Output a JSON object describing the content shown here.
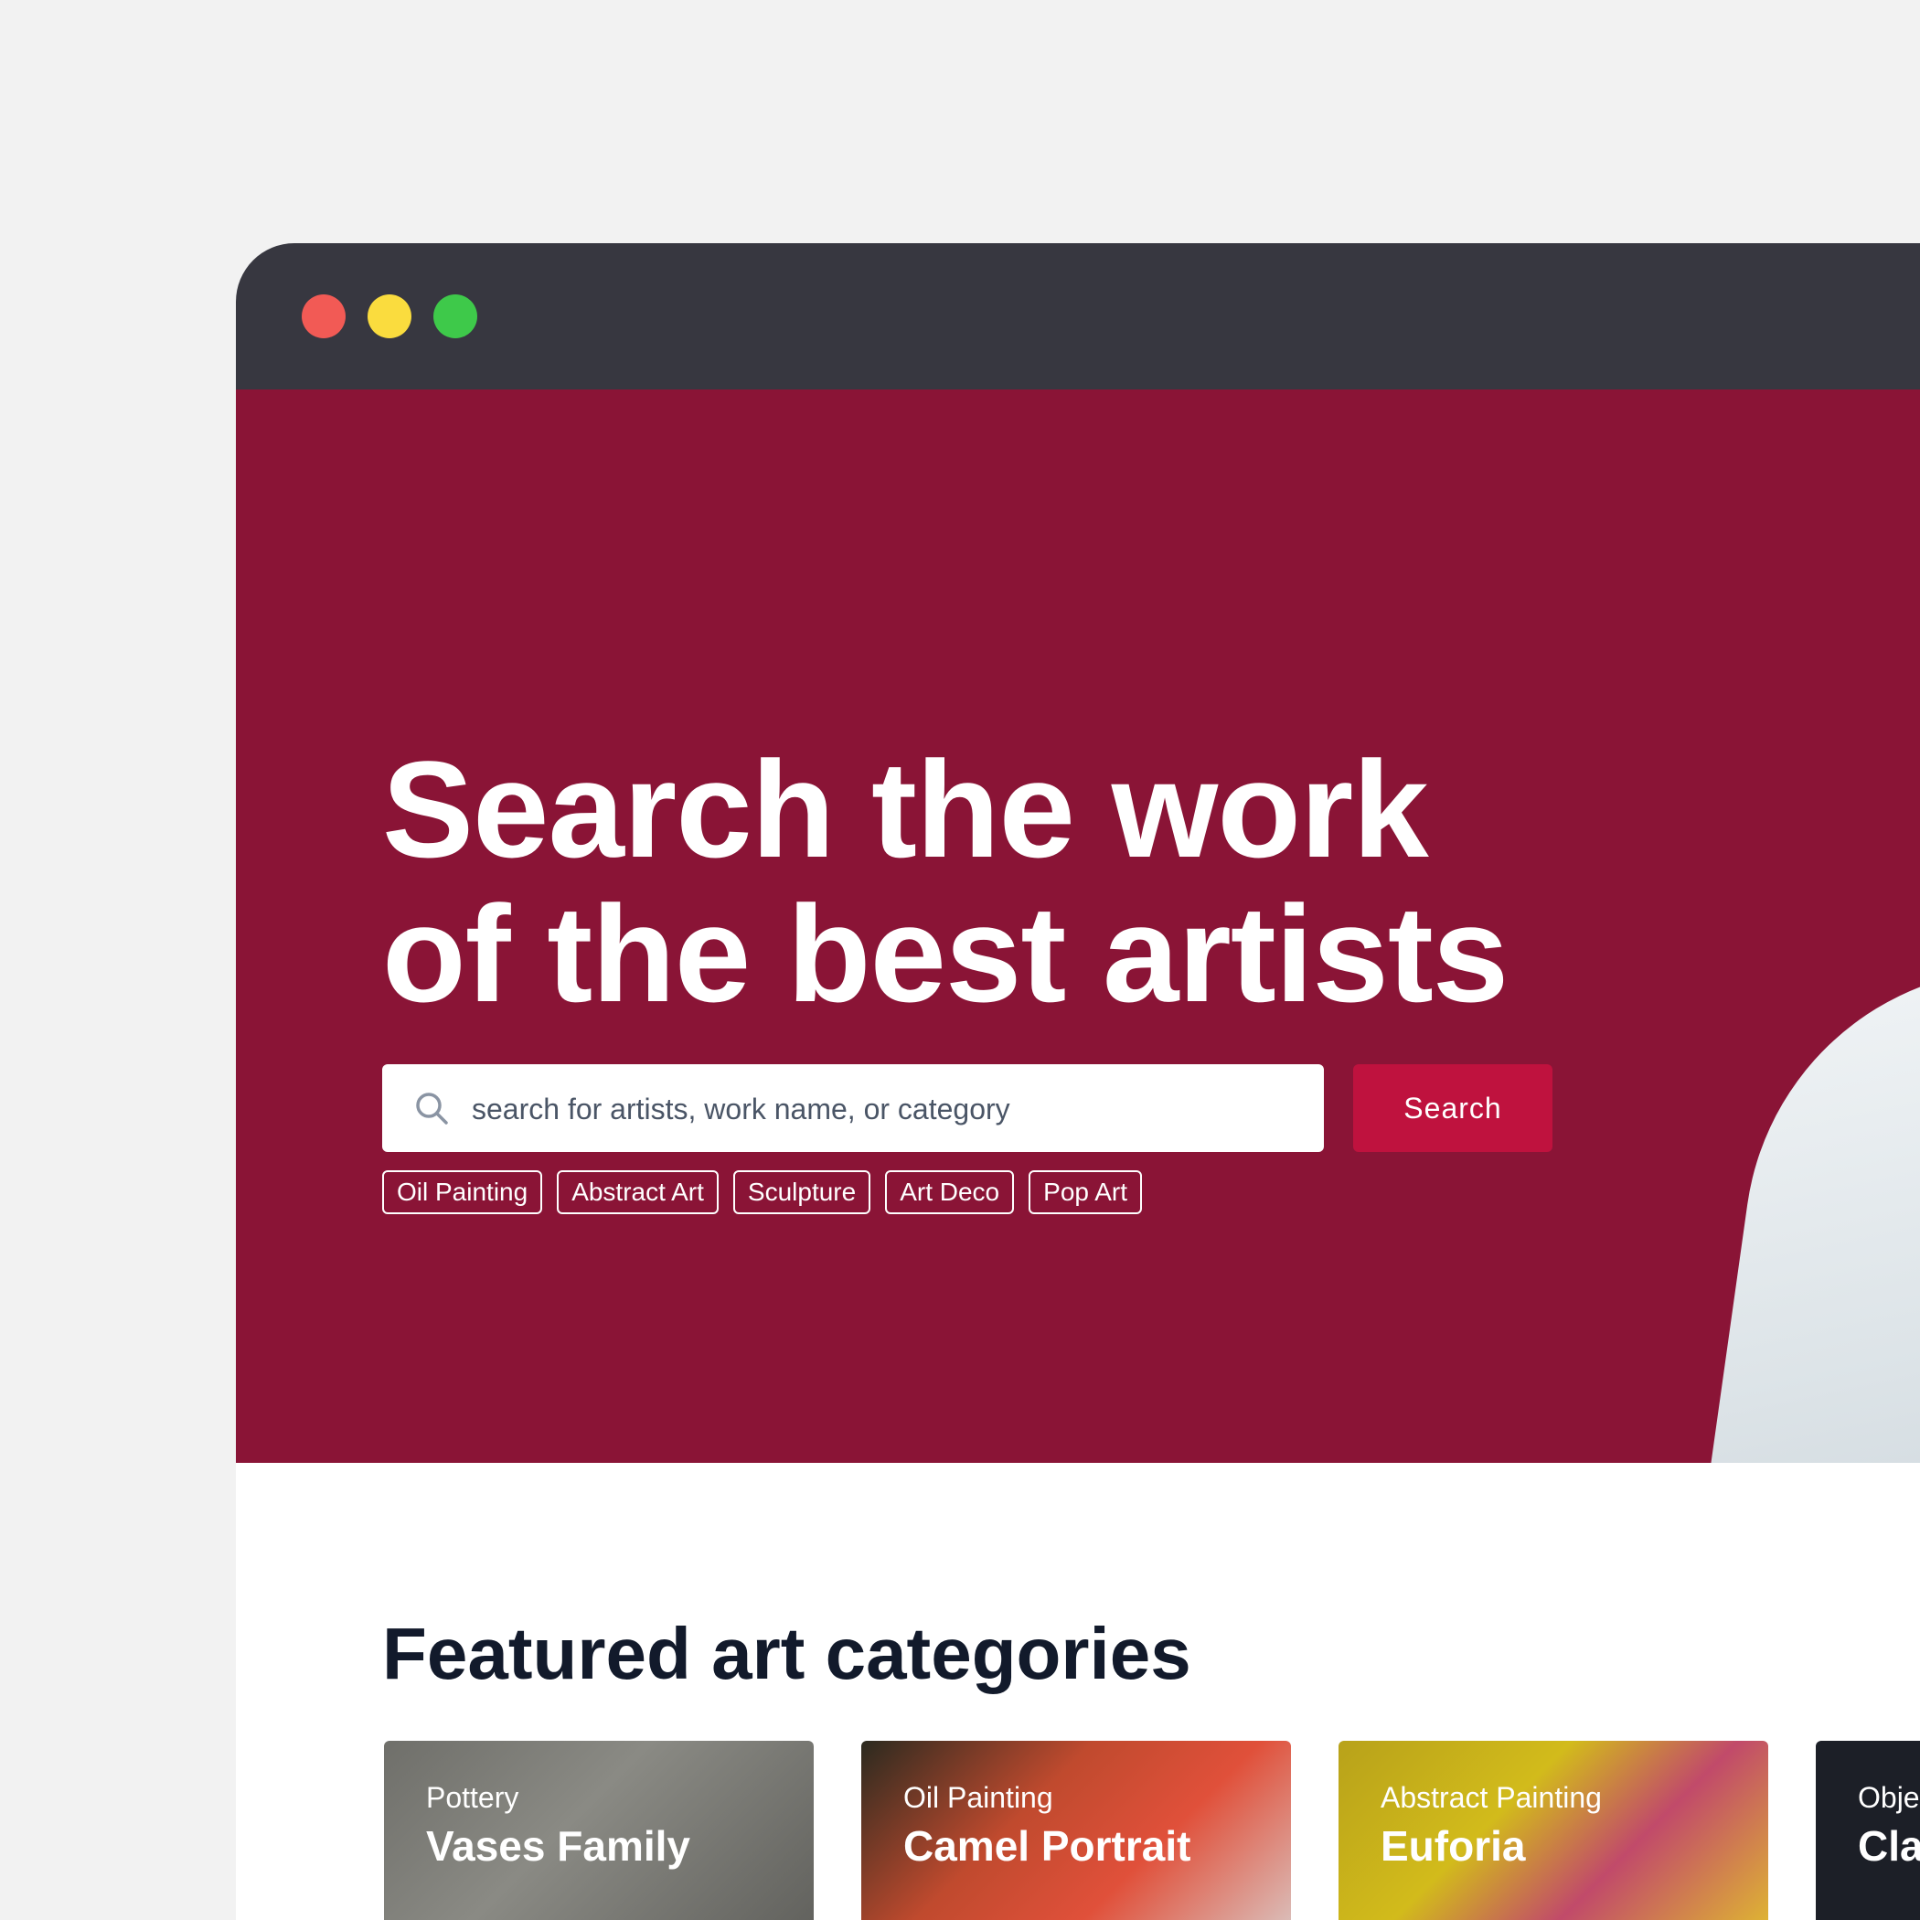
{
  "window": {
    "controls": [
      "close",
      "minimize",
      "maximize"
    ]
  },
  "hero": {
    "title": "Search the work of the best artists",
    "search": {
      "placeholder": "search for artists, work name, or category",
      "button_label": "Search"
    },
    "tags": [
      "Oil Painting",
      "Abstract Art",
      "Sculpture",
      "Art Deco",
      "Pop Art"
    ]
  },
  "featured": {
    "heading": "Featured art categories",
    "cards": [
      {
        "category": "Pottery",
        "title": "Vases Family"
      },
      {
        "category": "Oil Painting",
        "title": "Camel Portrait"
      },
      {
        "category": "Abstract Painting",
        "title": "Euforia"
      },
      {
        "category": "Obje",
        "title": "Cla"
      }
    ]
  },
  "colors": {
    "hero_background": "#8a1436",
    "accent": "#bf123e",
    "titlebar": "#373740"
  }
}
